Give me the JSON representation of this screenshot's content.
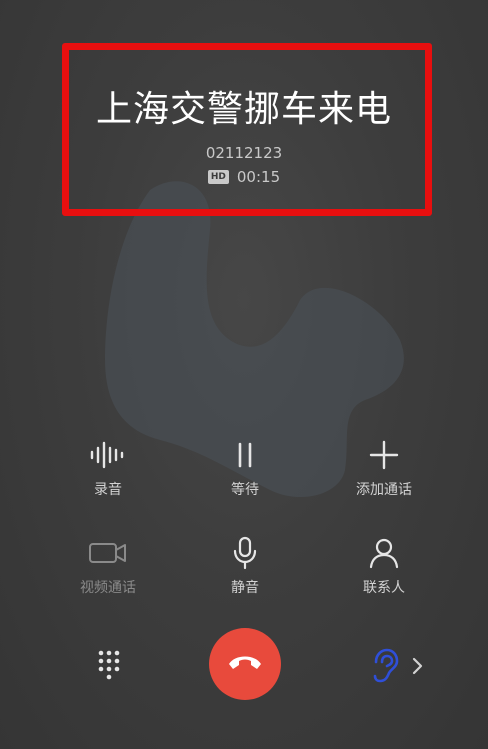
{
  "caller": {
    "name": "上海交警挪车来电",
    "number": "02112123",
    "hd_badge": "HD",
    "duration": "00:15"
  },
  "actions_row1": [
    {
      "label": "录音",
      "icon": "waveform-icon"
    },
    {
      "label": "等待",
      "icon": "pause-icon"
    },
    {
      "label": "添加通话",
      "icon": "plus-icon"
    }
  ],
  "actions_row2": [
    {
      "label": "视频通话",
      "icon": "video-camera-icon",
      "disabled": true
    },
    {
      "label": "静音",
      "icon": "microphone-icon"
    },
    {
      "label": "联系人",
      "icon": "person-icon"
    }
  ],
  "bottom_bar": {
    "dialpad_icon": "dialpad-icon",
    "end_call_icon": "phone-hangup-icon",
    "audio_icon": "ear-icon",
    "more_icon": "chevron-right-icon"
  },
  "colors": {
    "end_call": "#e84a3c",
    "highlight": "#e80f0f",
    "ear_icon": "#2f4fd8"
  }
}
